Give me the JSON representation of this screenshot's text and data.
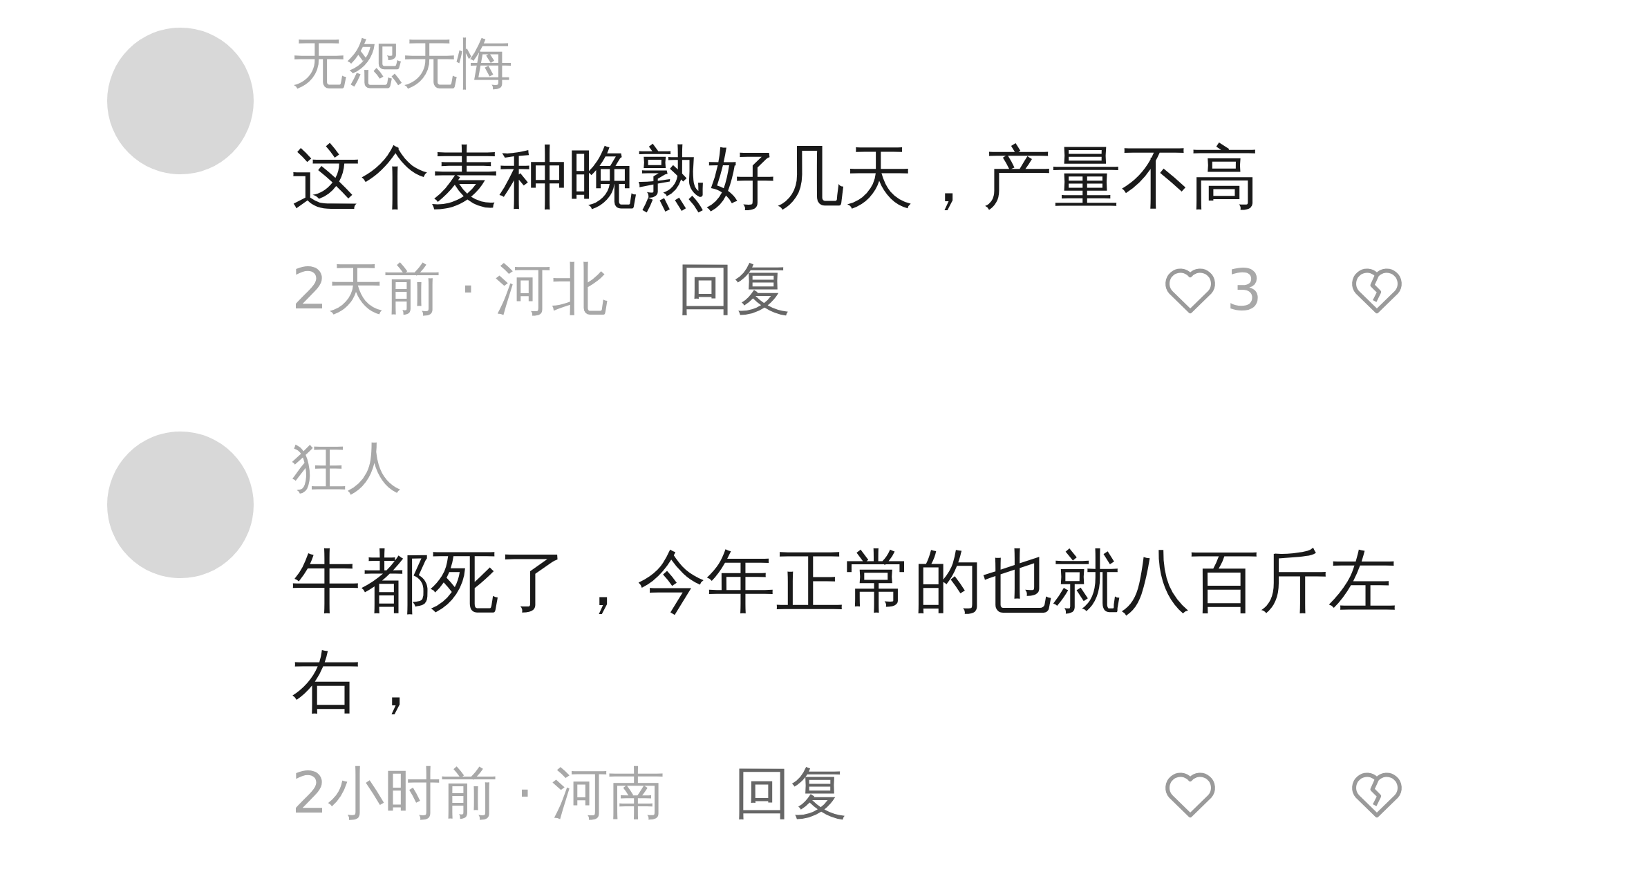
{
  "comments": [
    {
      "author": "无怨无悔",
      "text": "这个麦种晚熟好几天，产量不高",
      "meta": "2天前 · 河北",
      "reply": "回复",
      "likes": "3"
    },
    {
      "author": "狂人",
      "text": "牛都死了，今年正常的也就八百斤左右，",
      "meta": "2小时前 · 河南",
      "reply": "回复"
    }
  ]
}
